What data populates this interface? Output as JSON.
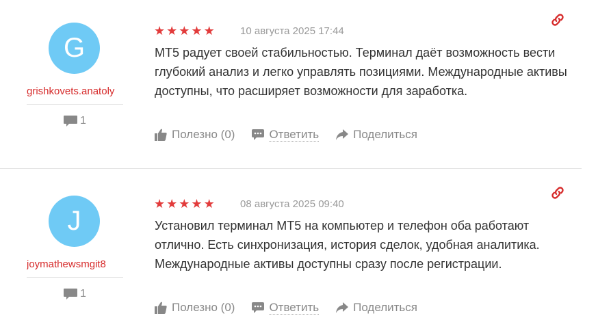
{
  "reviews": [
    {
      "avatar_letter": "G",
      "username": "grishkovets.anatoly",
      "comment_count": "1",
      "rating": 5,
      "stars": "★★★★★",
      "date": "10 августа 2025 17:44",
      "text": "MT5 радует своей стабильностью. Терминал даёт возможность вести глубокий анализ и легко управлять позициями. Международные активы доступны, что расширяет возможности для заработка.",
      "useful_label": "Полезно (0)",
      "reply_label": "Ответить",
      "share_label": "Поделиться"
    },
    {
      "avatar_letter": "J",
      "username": "joymathewsmgit8",
      "comment_count": "1",
      "rating": 5,
      "stars": "★★★★★",
      "date": "08 августа 2025 09:40",
      "text": "Установил терминал MT5 на компьютер и телефон оба работают отлично. Есть синхронизация, история сделок, удобная аналитика. Международные активы доступны сразу после регистрации.",
      "useful_label": "Полезно (0)",
      "reply_label": "Ответить",
      "share_label": "Поделиться"
    }
  ],
  "icons": {
    "permalink": "link-icon",
    "comments": "comment-bubble-icon",
    "useful": "thumbs-up-icon",
    "reply": "speech-bubble-icon",
    "share": "share-arrow-icon"
  },
  "colors": {
    "accent": "#d62a2a",
    "stars": "#e23b3b",
    "avatar": "#6fcaf5",
    "muted": "#888888"
  }
}
